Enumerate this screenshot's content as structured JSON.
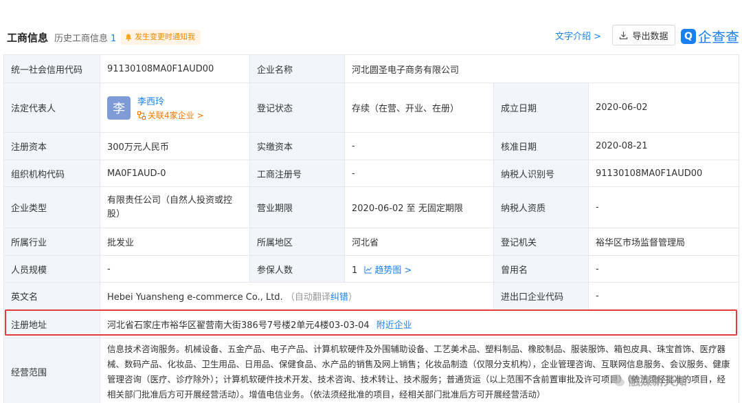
{
  "header": {
    "title": "工商信息",
    "history_label": "历史工商信息",
    "history_count": "1",
    "notify_label": "发生变更时通知我",
    "intro_link": "文字介绍 >",
    "export_label": "导出数据",
    "logo_text": "企查查"
  },
  "rows": {
    "credit_code_label": "统一社会信用代码",
    "credit_code_value": "91130108MA0F1AUD00",
    "company_name_label": "企业名称",
    "company_name_value": "河北圆圣电子商务有限公司",
    "legal_rep_label": "法定代表人",
    "legal_rep_avatar": "李",
    "legal_rep_name": "李西玲",
    "legal_rep_related": "关联4家企业 >",
    "reg_status_label": "登记状态",
    "reg_status_value": "存续（在营、开业、在册）",
    "established_label": "成立日期",
    "established_value": "2020-06-02",
    "reg_capital_label": "注册资本",
    "reg_capital_value": "300万元人民币",
    "paid_capital_label": "实缴资本",
    "paid_capital_value": "-",
    "approval_date_label": "核准日期",
    "approval_date_value": "2020-08-21",
    "org_code_label": "组织机构代码",
    "org_code_value": "MA0F1AUD-0",
    "biz_reg_no_label": "工商注册号",
    "biz_reg_no_value": "-",
    "taxpayer_id_label": "纳税人识别号",
    "taxpayer_id_value": "91130108MA0F1AUD00",
    "company_type_label": "企业类型",
    "company_type_value": "有限责任公司（自然人投资或控股）",
    "biz_term_label": "营业期限",
    "biz_term_value": "2020-06-02 至 无固定期限",
    "taxpayer_qual_label": "纳税人资质",
    "taxpayer_qual_value": "-",
    "industry_label": "所属行业",
    "industry_value": "批发业",
    "region_label": "所属地区",
    "region_value": "河北省",
    "reg_authority_label": "登记机关",
    "reg_authority_value": "裕华区市场监督管理局",
    "staff_size_label": "人员规模",
    "staff_size_value": "-",
    "insured_label": "参保人数",
    "insured_value": "1",
    "insured_trend": "趋势图 >",
    "former_name_label": "曾用名",
    "former_name_value": "-",
    "english_name_label": "英文名",
    "english_name_value": "Hebei Yuansheng e-commerce Co., Ltd.",
    "english_name_note_open": "（自动翻译",
    "english_name_correct": "纠错",
    "english_name_note_close": "）",
    "import_export_label": "进出口企业代码",
    "import_export_value": "-",
    "address_label": "注册地址",
    "address_value": "河北省石家庄市裕华区翟营南大街386号7号楼2单元4楼03-03-04",
    "address_nearby": "附近企业",
    "scope_label": "经营范围",
    "scope_value": "信息技术咨询服务。机械设备、五金产品、电子产品、计算机软硬件及外围辅助设备、工艺美术品、塑料制品、橡胶制品、服装服饰、箱包皮具、珠宝首饰、医疗器械、数码产品、化妆品、卫生用品、日用品、保健食品、水产品的销售及网上销售；化妆品制造（仅限分支机构），企业管理咨询、互联网信息服务、会议服务、健康管理咨询（医疗、诊疗除外）；计算机软硬件技术开发、技术咨询、技术转让、技术服务；普通货运（以上范围不含前置审批及许可项目）（依法须经批准的项目，经相关部门批准后方可开展经营活动）。增值电信业务。（依法须经批准的项目，经相关部门批准后方可开展经营活动）"
  },
  "watermark": {
    "text": "融媒新天知"
  },
  "colors": {
    "accent": "#1a7ff0",
    "label_bg": "#f2f6fb",
    "border": "#e4e8ee",
    "highlight_box": "#e23b3b",
    "related_orange": "#f07800"
  }
}
